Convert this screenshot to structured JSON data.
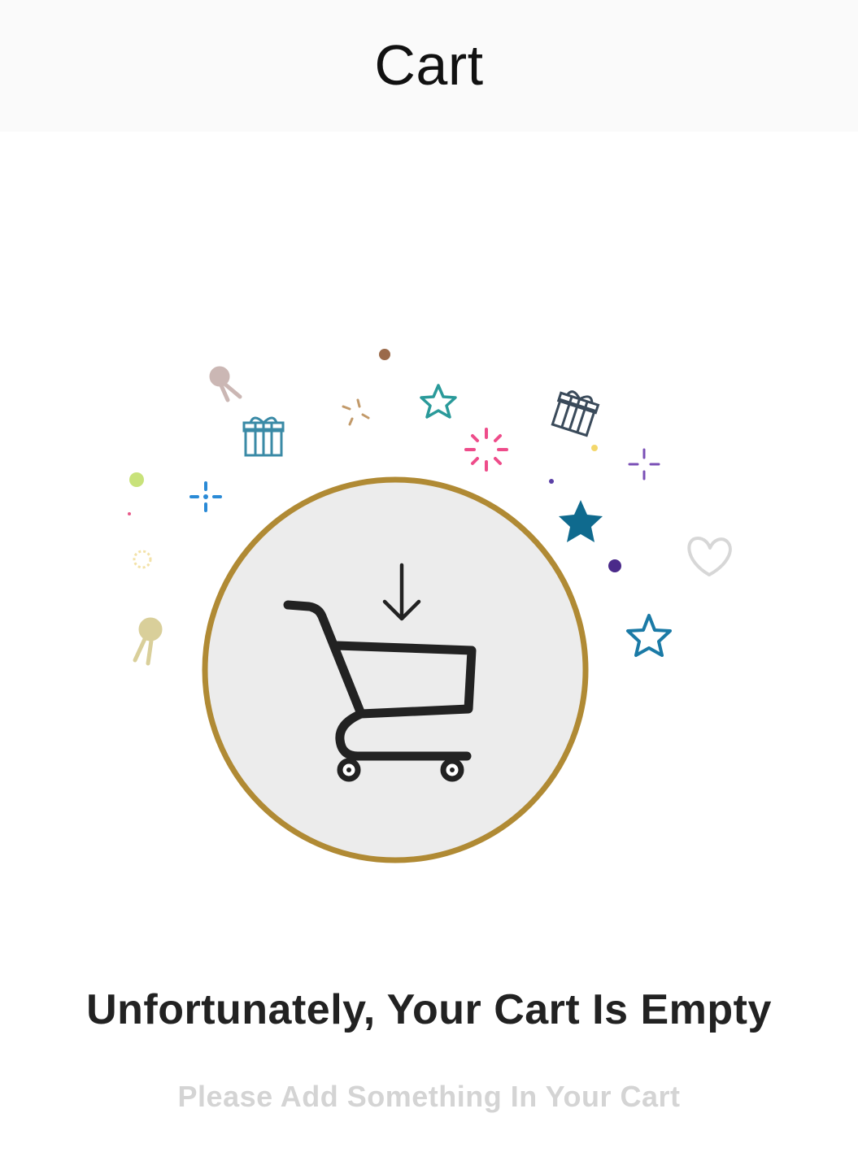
{
  "header": {
    "title": "Cart"
  },
  "empty_state": {
    "title": "Unfortunately, Your Cart Is Empty",
    "subtitle": "Please Add Something In Your Cart",
    "illustration_icon": "shopping-cart-icon",
    "circle_border_color": "#b08a34",
    "circle_fill_color": "#ececec"
  }
}
